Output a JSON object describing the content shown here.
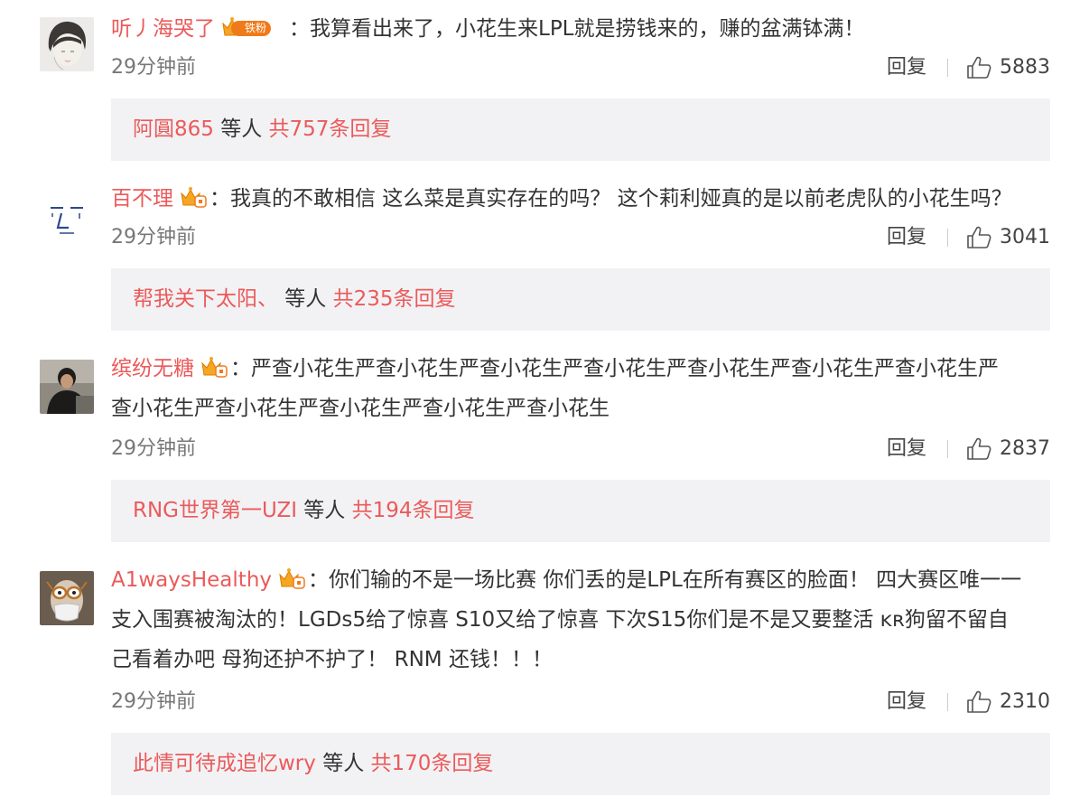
{
  "theme": {
    "username_color": "#eb5a5a",
    "reply_bar_bg": "#f2f2f5",
    "badge_color": "#f07a1a"
  },
  "comments": [
    {
      "username": "听丿海哭了",
      "badge_tag": "铁粉",
      "separator": "：",
      "lines": [
        "我算看出来了，小花生来LPL就是捞钱来的，赚的盆满钵满！"
      ],
      "time": "29分钟前",
      "reply_label": "回复",
      "likes": "5883",
      "reply_bar": {
        "name": "阿圓865",
        "middle": " 等人 ",
        "total": "共757条回复"
      }
    },
    {
      "username": "百不理",
      "badge_tag": "",
      "separator": "：",
      "lines": [
        "我真的不敢相信 这么菜是真实存在的吗？ 这个莉利娅真的是以前老虎队的小花生吗？"
      ],
      "time": "29分钟前",
      "reply_label": "回复",
      "likes": "3041",
      "reply_bar": {
        "name": "帮我关下太阳、",
        "middle": " 等人 ",
        "total": "共235条回复"
      }
    },
    {
      "username": "缤纷无糖",
      "badge_tag": "",
      "separator": "：",
      "lines": [
        "严查小花生严查小花生严查小花生严查小花生严查小花生严查小花生严查小花生严",
        "查小花生严查小花生严查小花生严查小花生严查小花生"
      ],
      "time": "29分钟前",
      "reply_label": "回复",
      "likes": "2837",
      "reply_bar": {
        "name": "RNG世界第一UZI",
        "middle": " 等人 ",
        "total": "共194条回复"
      }
    },
    {
      "username": "A1waysHealthy",
      "badge_tag": "",
      "separator": "：",
      "lines": [
        "你们输的不是一场比赛 你们丢的是LPL在所有赛区的脸面！ 四大赛区唯一一",
        "支入围赛被淘汰的！LGDs5给了惊喜 S10又给了惊喜 下次S15你们是不是又要整活 ᴋʀ狗留不留自",
        "己看着办吧 母狗还护不护了！ RNM 还钱！！！"
      ],
      "time": "29分钟前",
      "reply_label": "回复",
      "likes": "2310",
      "reply_bar": {
        "name": "此情可待成追忆wry",
        "middle": " 等人 ",
        "total": "共170条回复"
      }
    }
  ]
}
